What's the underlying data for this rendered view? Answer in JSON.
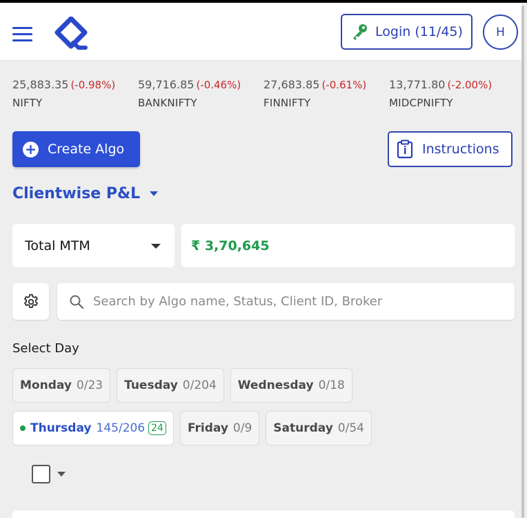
{
  "header": {
    "login_label": "Login (11/45)",
    "avatar_initial": "H"
  },
  "indices": [
    {
      "value": "25,883.35",
      "change": "(-0.98%)",
      "name": "NIFTY"
    },
    {
      "value": "59,716.85",
      "change": "(-0.46%)",
      "name": "BANKNIFTY"
    },
    {
      "value": "27,683.85",
      "change": "(-0.61%)",
      "name": "FINNIFTY"
    },
    {
      "value": "13,771.80",
      "change": "(-2.00%)",
      "name": "MIDCPNIFTY"
    }
  ],
  "actions": {
    "create_algo": "Create Algo",
    "instructions": "Instructions"
  },
  "pl": {
    "title": "Clientwise P&L",
    "metric": "Total MTM",
    "value": "₹ 3,70,645"
  },
  "search": {
    "placeholder": "Search by Algo name, Status, Client ID, Broker"
  },
  "days": {
    "label": "Select Day",
    "row1": [
      {
        "day": "Monday",
        "count": "0/23"
      },
      {
        "day": "Tuesday",
        "count": "0/204"
      },
      {
        "day": "Wednesday",
        "count": "0/18"
      }
    ],
    "row2": [
      {
        "day": "Thursday",
        "count": "145/206",
        "badge": "24"
      },
      {
        "day": "Friday",
        "count": "0/9"
      },
      {
        "day": "Saturday",
        "count": "0/54"
      }
    ]
  },
  "colors": {
    "primary": "#2c4fd6",
    "negative": "#c62828",
    "positive": "#1e9a4a"
  }
}
